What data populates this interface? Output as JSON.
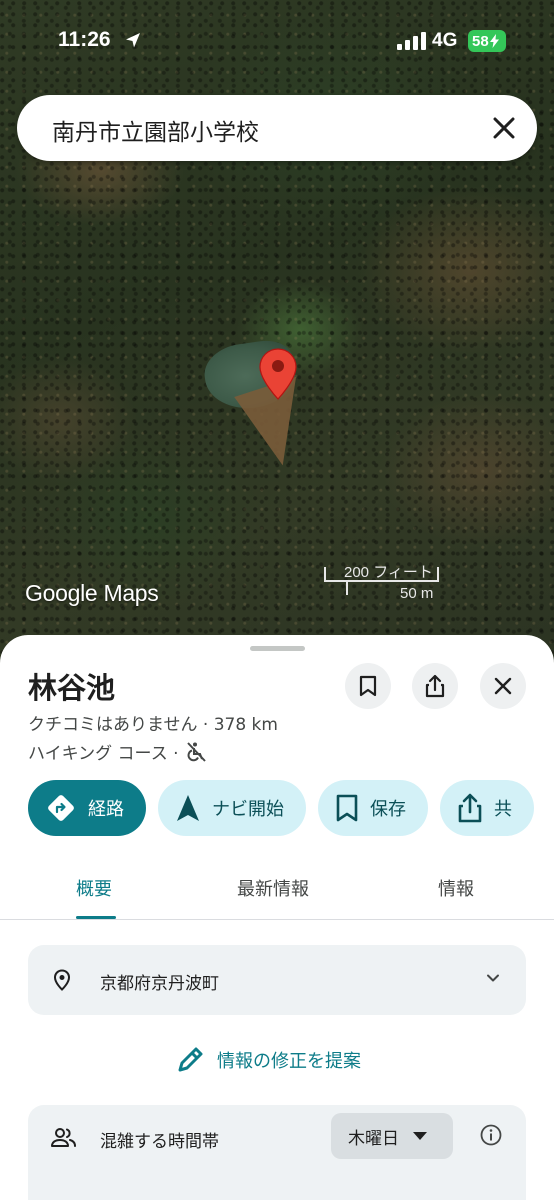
{
  "status_bar": {
    "time": "11:26",
    "network": "4G",
    "battery": "58"
  },
  "search": {
    "query": "南丹市立園部小学校"
  },
  "map": {
    "logo": "Google Maps",
    "scale_feet": "200 フィート",
    "scale_meters": "50 m"
  },
  "place": {
    "name": "林谷池",
    "reviews_distance": "クチコミはありません · 378 km",
    "category": "ハイキング コース ·"
  },
  "actions": [
    {
      "label": "経路",
      "icon": "directions-icon"
    },
    {
      "label": "ナビ開始",
      "icon": "navigation-arrow-icon"
    },
    {
      "label": "保存",
      "icon": "bookmark-icon"
    },
    {
      "label": "共",
      "icon": "share-icon"
    }
  ],
  "tabs": [
    "概要",
    "最新情報",
    "情報"
  ],
  "address": "京都府京丹波町",
  "suggest_edit": "情報の修正を提案",
  "popular_times": {
    "label": "混雑する時間帯",
    "day": "木曜日"
  },
  "colors": {
    "accent": "#0d7c89",
    "chip_bg": "#d3f1f7",
    "pin": "#ea4335",
    "battery": "#34c759"
  }
}
